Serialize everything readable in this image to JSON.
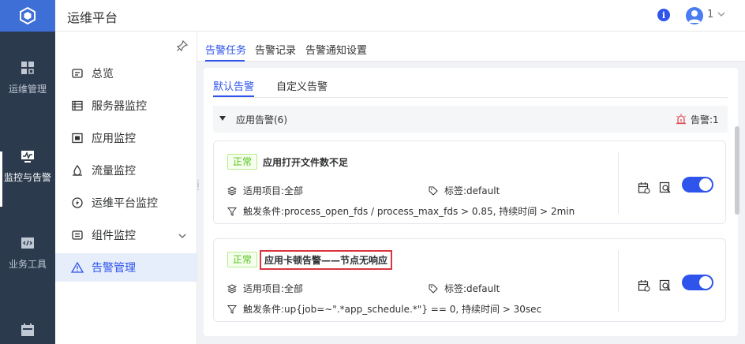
{
  "app": {
    "title": "运维平台"
  },
  "header": {
    "user_name": "1",
    "info_icon": "info-icon",
    "avatar_icon": "user-avatar-icon"
  },
  "rail": {
    "items": [
      {
        "label": "运维管理",
        "icon": "dashboard-grid-icon"
      },
      {
        "label": "监控与告警",
        "icon": "monitor-screen-icon",
        "active": true
      },
      {
        "label": "业务工具",
        "icon": "code-window-icon"
      },
      {
        "label": "",
        "icon": "calendar-icon"
      }
    ]
  },
  "sidebar": {
    "items": [
      {
        "label": "总览",
        "icon": "overview-icon"
      },
      {
        "label": "服务器监控",
        "icon": "server-list-icon"
      },
      {
        "label": "应用监控",
        "icon": "app-monitor-icon"
      },
      {
        "label": "流量监控",
        "icon": "traffic-icon"
      },
      {
        "label": "运维平台监控",
        "icon": "platform-monitor-icon"
      },
      {
        "label": "组件监控",
        "icon": "component-icon",
        "expandable": true
      },
      {
        "label": "告警管理",
        "icon": "alert-warning-icon",
        "active": true
      }
    ]
  },
  "tabs": [
    {
      "label": "告警任务",
      "active": true
    },
    {
      "label": "告警记录"
    },
    {
      "label": "告警通知设置"
    }
  ],
  "subtabs": [
    {
      "label": "默认告警",
      "active": true
    },
    {
      "label": "自定义告警"
    }
  ],
  "group": {
    "title": "应用告警(6)",
    "alarm_label": "告警:1"
  },
  "cards": [
    {
      "status": "正常",
      "title": "应用打开文件数不足",
      "project_label": "适用项目:",
      "project_value": "全部",
      "tag_label": "标签:",
      "tag_value": "default",
      "trigger_label": "触发条件:",
      "trigger_value": "process_open_fds / process_max_fds > 0.85, 持续时间 > 2min",
      "enabled": true
    },
    {
      "status": "正常",
      "title": "应用卡顿告警——节点无响应",
      "project_label": "适用项目:",
      "project_value": "全部",
      "tag_label": "标签:",
      "tag_value": "default",
      "trigger_label": "触发条件:",
      "trigger_value": "up{job=~\".*app_schedule.*\"} == 0, 持续时间 > 30sec",
      "enabled": true,
      "highlighted": true
    }
  ],
  "colors": {
    "primary": "#2f54eb",
    "rail_bg": "#2b3a4d",
    "logo_bg": "#3d6fd6",
    "success": "#52c41a",
    "highlight_border": "#d9363e"
  }
}
